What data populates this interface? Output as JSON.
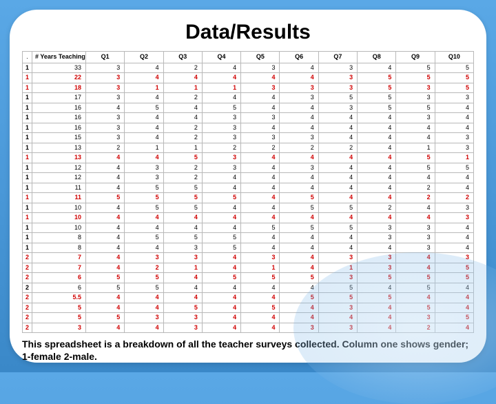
{
  "title": "Data/Results",
  "caption": "This spreadsheet is a breakdown of all the teacher surveys collected. Column one shows gender; 1-female 2-male.",
  "headers": [
    ".",
    "# Years Teaching",
    "Q1",
    "Q2",
    "Q3",
    "Q4",
    "Q5",
    "Q6",
    "Q7",
    "Q8",
    "Q9",
    "Q10"
  ],
  "chart_data": {
    "type": "table",
    "columns": [
      "gender",
      "years_teaching",
      "Q1",
      "Q2",
      "Q3",
      "Q4",
      "Q5",
      "Q6",
      "Q7",
      "Q8",
      "Q9",
      "Q10"
    ],
    "rows": [
      {
        "gender": 1,
        "years": 33,
        "vals": [
          3,
          4,
          2,
          4,
          3,
          4,
          3,
          4,
          5,
          5
        ],
        "hl": false
      },
      {
        "gender": 1,
        "years": 22,
        "vals": [
          3,
          4,
          4,
          4,
          4,
          4,
          3,
          5,
          5,
          5
        ],
        "hl": true
      },
      {
        "gender": 1,
        "years": 18,
        "vals": [
          3,
          1,
          1,
          1,
          3,
          3,
          3,
          5,
          3,
          5
        ],
        "hl": true
      },
      {
        "gender": 1,
        "years": 17,
        "vals": [
          3,
          4,
          2,
          4,
          4,
          3,
          5,
          5,
          3,
          3
        ],
        "hl": false
      },
      {
        "gender": 1,
        "years": 16,
        "vals": [
          4,
          5,
          4,
          5,
          4,
          4,
          3,
          5,
          5,
          4
        ],
        "hl": false
      },
      {
        "gender": 1,
        "years": 16,
        "vals": [
          3,
          4,
          4,
          3,
          3,
          4,
          4,
          4,
          3,
          4
        ],
        "hl": false
      },
      {
        "gender": 1,
        "years": 16,
        "vals": [
          3,
          4,
          2,
          3,
          4,
          4,
          4,
          4,
          4,
          4
        ],
        "hl": false
      },
      {
        "gender": 1,
        "years": 15,
        "vals": [
          3,
          4,
          2,
          3,
          3,
          3,
          4,
          4,
          4,
          3
        ],
        "hl": false
      },
      {
        "gender": 1,
        "years": 13,
        "vals": [
          2,
          1,
          1,
          2,
          2,
          2,
          2,
          4,
          1,
          3
        ],
        "hl": false
      },
      {
        "gender": 1,
        "years": 13,
        "vals": [
          4,
          4,
          5,
          3,
          4,
          4,
          4,
          4,
          5,
          1
        ],
        "hl": true
      },
      {
        "gender": 1,
        "years": 12,
        "vals": [
          4,
          3,
          2,
          3,
          4,
          3,
          4,
          4,
          5,
          5
        ],
        "hl": false
      },
      {
        "gender": 1,
        "years": 12,
        "vals": [
          4,
          3,
          2,
          4,
          4,
          4,
          4,
          4,
          4,
          4
        ],
        "hl": false
      },
      {
        "gender": 1,
        "years": 11,
        "vals": [
          4,
          5,
          5,
          4,
          4,
          4,
          4,
          4,
          2,
          4
        ],
        "hl": false
      },
      {
        "gender": 1,
        "years": 11,
        "vals": [
          5,
          5,
          5,
          5,
          4,
          5,
          4,
          4,
          2,
          2
        ],
        "hl": true
      },
      {
        "gender": 1,
        "years": 10,
        "vals": [
          4,
          5,
          5,
          4,
          4,
          5,
          5,
          2,
          4,
          3
        ],
        "hl": false
      },
      {
        "gender": 1,
        "years": 10,
        "vals": [
          4,
          4,
          4,
          4,
          4,
          4,
          4,
          4,
          4,
          3
        ],
        "hl": true
      },
      {
        "gender": 1,
        "years": 10,
        "vals": [
          4,
          4,
          4,
          4,
          5,
          5,
          5,
          3,
          3,
          4
        ],
        "hl": false
      },
      {
        "gender": 1,
        "years": 8,
        "vals": [
          4,
          5,
          5,
          5,
          4,
          4,
          4,
          3,
          3,
          4
        ],
        "hl": false
      },
      {
        "gender": 1,
        "years": 8,
        "vals": [
          4,
          4,
          3,
          5,
          4,
          4,
          4,
          4,
          3,
          4
        ],
        "hl": false
      },
      {
        "gender": 2,
        "years": 7,
        "vals": [
          4,
          3,
          3,
          4,
          3,
          4,
          3,
          3,
          4,
          3
        ],
        "hl": true
      },
      {
        "gender": 2,
        "years": 7,
        "vals": [
          4,
          2,
          1,
          4,
          1,
          4,
          1,
          3,
          4,
          5
        ],
        "hl": true
      },
      {
        "gender": 2,
        "years": 6,
        "vals": [
          5,
          5,
          4,
          5,
          5,
          5,
          3,
          5,
          5,
          5
        ],
        "hl": true
      },
      {
        "gender": 2,
        "years": 6,
        "vals": [
          5,
          5,
          4,
          4,
          4,
          4,
          5,
          4,
          5,
          4
        ],
        "hl": false
      },
      {
        "gender": 2,
        "years": 5.5,
        "vals": [
          4,
          4,
          4,
          4,
          4,
          5,
          5,
          5,
          4,
          4
        ],
        "hl": true
      },
      {
        "gender": 2,
        "years": 5,
        "vals": [
          4,
          4,
          5,
          4,
          5,
          4,
          3,
          4,
          5,
          4
        ],
        "hl": true
      },
      {
        "gender": 2,
        "years": 5,
        "vals": [
          5,
          3,
          3,
          4,
          4,
          4,
          4,
          4,
          3,
          5
        ],
        "hl": true
      },
      {
        "gender": 2,
        "years": 3,
        "vals": [
          4,
          4,
          3,
          4,
          4,
          3,
          3,
          4,
          2,
          4
        ],
        "hl": true
      }
    ]
  }
}
